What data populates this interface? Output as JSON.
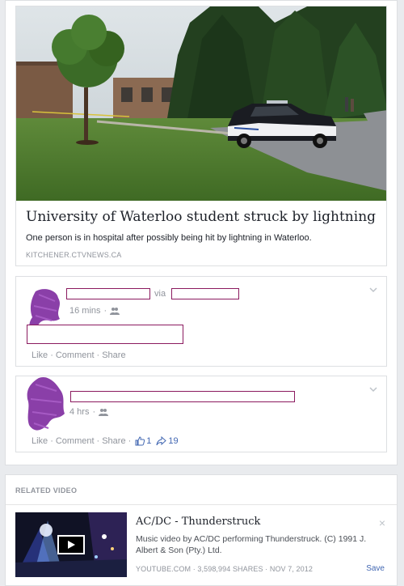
{
  "link_preview": {
    "headline": "University of Waterloo student struck by lightning",
    "description": "One person is in hospital after possibly being hit by lightning in Waterloo.",
    "domain": "KITCHENER.CTVNEWS.CA",
    "image_icon": "news-photo"
  },
  "comments": [
    {
      "via_text": "via",
      "time": "16 mins",
      "privacy_icon": "friends-icon",
      "actions": [
        "Like",
        "Comment",
        "Share"
      ]
    },
    {
      "time": "4 hrs",
      "privacy_icon": "friends-icon",
      "actions": [
        "Like",
        "Comment",
        "Share"
      ],
      "like_count": "1",
      "share_count": "19"
    }
  ],
  "related_video": {
    "section_label": "RELATED VIDEO",
    "title": "AC/DC - Thunderstruck",
    "description": "Music video by AC/DC performing Thunderstruck. (C) 1991 J. Albert & Son (Pty.) Ltd.",
    "meta": "YOUTUBE.COM · 3,598,994 SHARES · NOV 7, 2012",
    "save_label": "Save",
    "close_glyph": "×"
  },
  "colors": {
    "redaction_border": "#8b1a5f",
    "scribble": "#8a3fa8",
    "link_blue": "#4267b2",
    "meta_gray": "#90949c"
  }
}
